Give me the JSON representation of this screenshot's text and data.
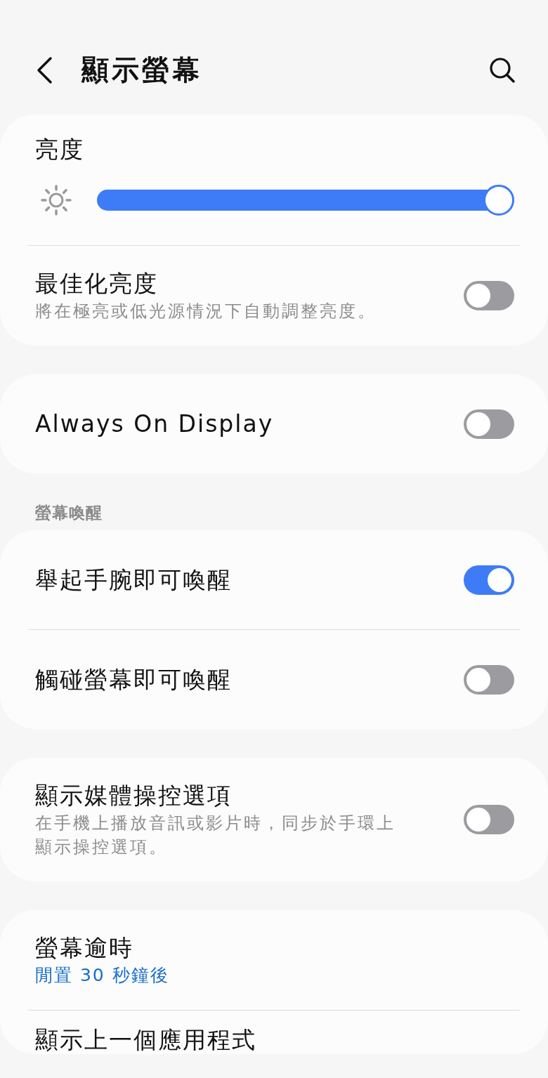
{
  "header": {
    "title": "顯示螢幕"
  },
  "groups": [
    {
      "items": [
        {
          "kind": "slider",
          "title": "亮度",
          "level": 1.0
        },
        {
          "kind": "toggle",
          "title": "最佳化亮度",
          "subtitle": "將在極亮或低光源情況下自動調整亮度。",
          "on": false
        }
      ]
    },
    {
      "items": [
        {
          "kind": "toggle",
          "title": "Always On Display",
          "on": false
        }
      ]
    },
    {
      "section": "螢幕喚醒",
      "items": [
        {
          "kind": "toggle",
          "title": "舉起手腕即可喚醒",
          "on": true
        },
        {
          "kind": "toggle",
          "title": "觸碰螢幕即可喚醒",
          "on": false
        }
      ]
    },
    {
      "items": [
        {
          "kind": "toggle",
          "title": "顯示媒體操控選項",
          "subtitle": "在手機上播放音訊或影片時，同步於手環上顯示操控選項。",
          "on": false
        }
      ]
    },
    {
      "items": [
        {
          "kind": "value",
          "title": "螢幕逾時",
          "value": "閒置 30 秒鐘後"
        },
        {
          "kind": "link",
          "title": "顯示上一個應用程式"
        }
      ]
    }
  ]
}
